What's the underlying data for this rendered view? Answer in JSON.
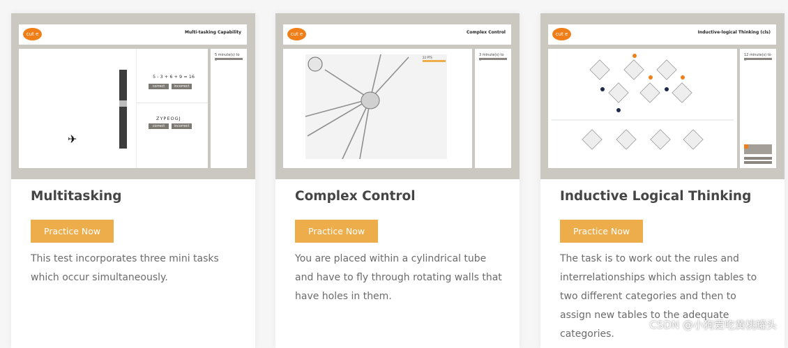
{
  "cards": [
    {
      "title": "Multitasking",
      "button_label": "Practice Now",
      "description": "This test incorporates three mini tasks which occur simultaneously.",
      "preview": {
        "logo_text": "cut e",
        "header_title": "Multi-tasking Capability",
        "timer_text": "5 minute(s) to go",
        "equation": "5 - 3 + 6 + 9 = 16",
        "letters": "ZYPEOGJ",
        "correct_label": "correct",
        "incorrect_label": "incorrect",
        "plane_glyph": "✈"
      }
    },
    {
      "title": "Complex Control",
      "button_label": "Practice Now",
      "description": "You are placed within a cylindrical tube and have to fly through rotating walls that have holes in them.",
      "preview": {
        "logo_text": "cut e",
        "header_title": "Complex Control",
        "timer_text": "3 minute(s) to go",
        "score_text": "22 PTS"
      }
    },
    {
      "title": "Inductive Logical Thinking",
      "button_label": "Practice Now",
      "description": "The task is to work out the rules and interrelationships which assign tables to two different categories and then to assign new tables to the adequate categories.",
      "preview": {
        "logo_text": "cut e",
        "header_title": "Inductive-logical Thinking (cls)",
        "timer_text": "12 minute(s) to go"
      }
    }
  ],
  "watermark": "CSDN @小狗爱吃黄桃罐头",
  "colors": {
    "accent": "#eead4b",
    "title": "#454545",
    "text": "#6b6b6b",
    "preview_bg": "#cbc7c1",
    "logo": "#f07f1a"
  }
}
